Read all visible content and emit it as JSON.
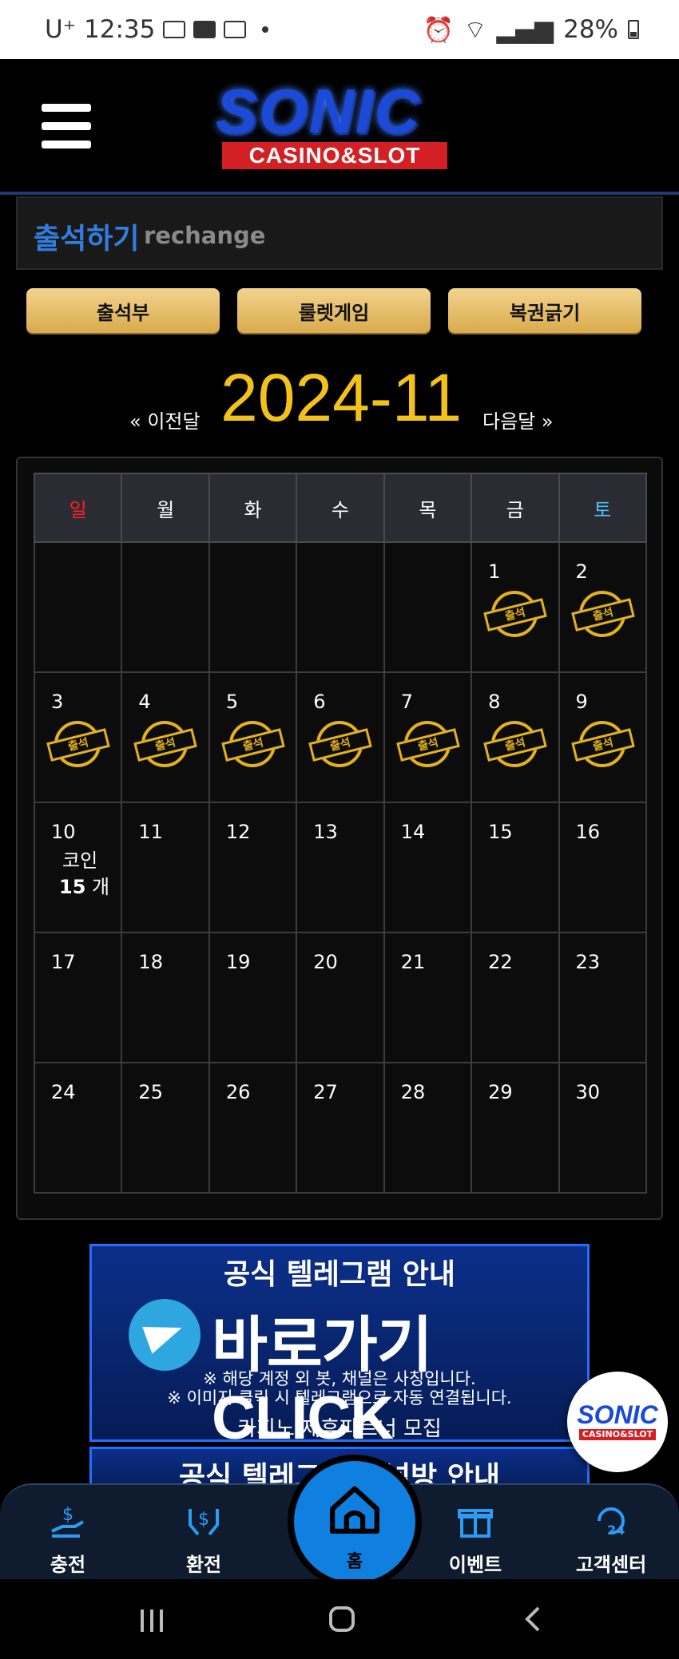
{
  "status_bar": {
    "carrier": "U⁺",
    "time": "12:35",
    "battery": "28%"
  },
  "header": {
    "logo_main": "SONIC",
    "logo_sub": "CASINO&SLOT"
  },
  "page_title": {
    "korean": "출석하기",
    "english": "rechange"
  },
  "tabs": [
    {
      "label": "출석부"
    },
    {
      "label": "룰렛게임"
    },
    {
      "label": "복권긁기"
    }
  ],
  "month_nav": {
    "prev": "« 이전달",
    "current": "2024-11",
    "next": "다음달 »"
  },
  "calendar": {
    "weekdays": [
      "일",
      "월",
      "화",
      "수",
      "목",
      "금",
      "토"
    ],
    "stamp_text": "출석",
    "today": {
      "day": 10,
      "coin_label": "코인",
      "coin_count": "15",
      "coin_unit": "개"
    },
    "weeks": [
      [
        null,
        null,
        null,
        null,
        null,
        {
          "day": "1",
          "stamp": true
        },
        {
          "day": "2",
          "stamp": true
        }
      ],
      [
        {
          "day": "3",
          "stamp": true
        },
        {
          "day": "4",
          "stamp": true
        },
        {
          "day": "5",
          "stamp": true
        },
        {
          "day": "6",
          "stamp": true
        },
        {
          "day": "7",
          "stamp": true
        },
        {
          "day": "8",
          "stamp": true
        },
        {
          "day": "9",
          "stamp": true
        }
      ],
      [
        {
          "day": "10"
        },
        {
          "day": "11"
        },
        {
          "day": "12"
        },
        {
          "day": "13"
        },
        {
          "day": "14"
        },
        {
          "day": "15"
        },
        {
          "day": "16"
        }
      ],
      [
        {
          "day": "17"
        },
        {
          "day": "18"
        },
        {
          "day": "19"
        },
        {
          "day": "20"
        },
        {
          "day": "21"
        },
        {
          "day": "22"
        },
        {
          "day": "23"
        }
      ],
      [
        {
          "day": "24"
        },
        {
          "day": "25"
        },
        {
          "day": "26"
        },
        {
          "day": "27"
        },
        {
          "day": "28"
        },
        {
          "day": "29"
        },
        {
          "day": "30"
        }
      ]
    ]
  },
  "banner": {
    "title": "공식 텔레그램 안내",
    "cta": "바로가기 CLICK",
    "note1": "※ 해당 계정 외 봇, 채널은 사칭입니다.",
    "note2": "※ 이미지 클릭 시 텔레그램으로 자동 연결됩니다.",
    "footer": "카지노 제휴파트너 모집"
  },
  "banner2": {
    "title": "공식 텔레그램 채널방 안내"
  },
  "float_logo": {
    "main": "SONIC",
    "sub": "CASINO&SLOT"
  },
  "bottom_nav": [
    {
      "label": "충전",
      "icon": "deposit-icon"
    },
    {
      "label": "환전",
      "icon": "exchange-icon"
    },
    {
      "label": "홈",
      "icon": "home-icon"
    },
    {
      "label": "이벤트",
      "icon": "gift-icon"
    },
    {
      "label": "고객센터",
      "icon": "support-24-icon"
    }
  ],
  "colors": {
    "accent_blue": "#2f7fe0",
    "gold": "#f3c21a",
    "tab_gold": "#e2b867",
    "sunday": "#ff2020",
    "saturday": "#4fc3f7"
  }
}
